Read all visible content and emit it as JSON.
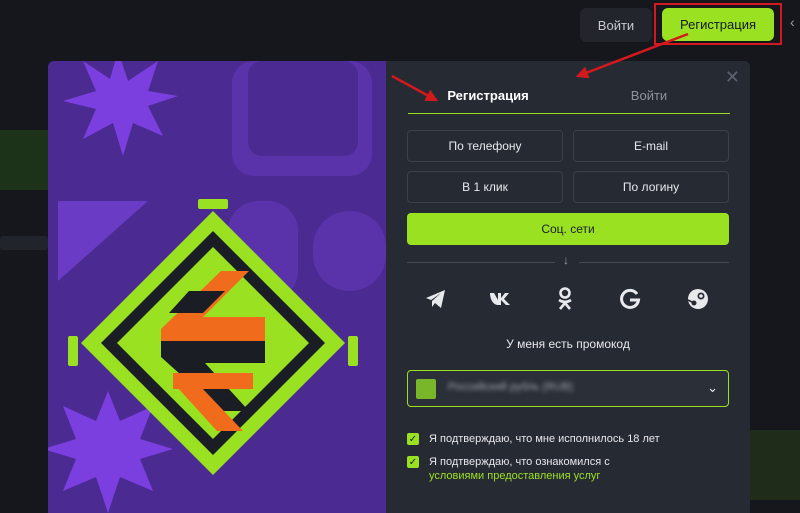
{
  "header": {
    "login_label": "Войти",
    "register_label": "Регистрация"
  },
  "modal": {
    "close_symbol": "✕",
    "tabs": [
      {
        "label": "Регистрация",
        "active": true
      },
      {
        "label": "Войти",
        "active": false
      }
    ],
    "methods": [
      "По телефону",
      "E-mail",
      "В 1 клик",
      "По логину"
    ],
    "social_label": "Соц. сети",
    "divider_symbol": "↓",
    "social_icons": [
      "telegram-icon",
      "vk-icon",
      "odnoklassniki-icon",
      "google-icon",
      "steam-icon"
    ],
    "promo_label": "У меня есть промокод",
    "currency": {
      "value": "Российский рубль (RUB)",
      "blurred": true
    },
    "checkboxes": [
      {
        "label": "Я подтверждаю, что мне исполнилось 18 лет",
        "checked": true
      },
      {
        "label": "Я подтверждаю, что ознакомился с",
        "checked": true
      }
    ],
    "terms_link": "условиями предоставления услуг"
  },
  "colors": {
    "accent": "#9ae122",
    "modal_bg": "#262a33",
    "art_bg": "#4b2a92",
    "annotation_red": "#d3191e",
    "page_bg": "#15171c"
  }
}
